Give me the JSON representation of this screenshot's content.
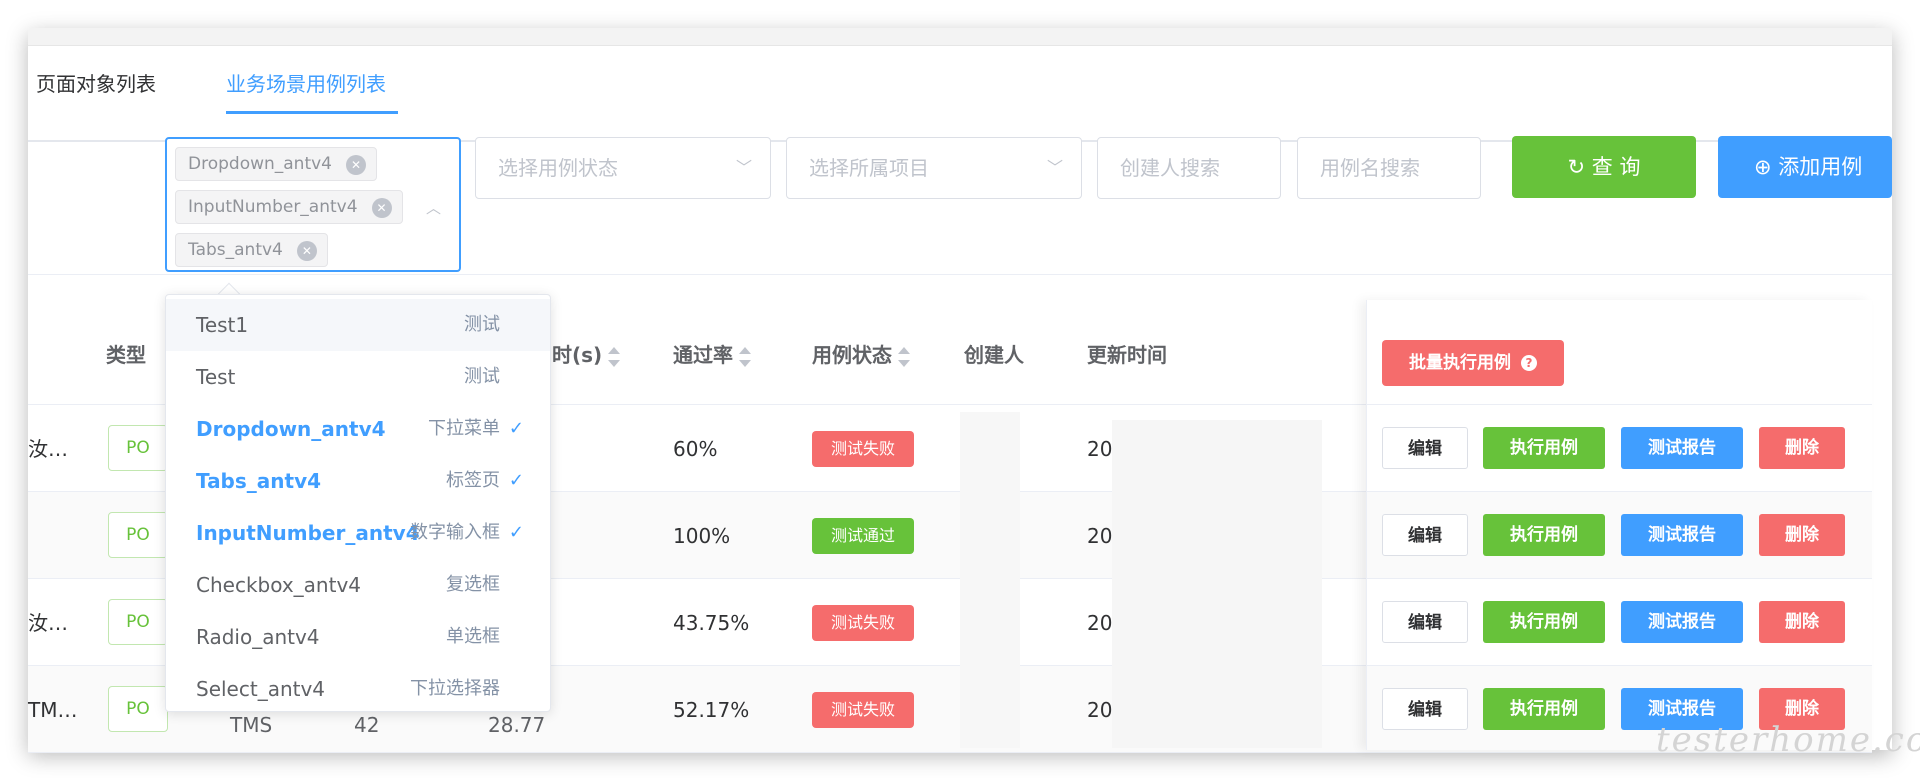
{
  "tabs": [
    {
      "label": "页面对象列表"
    },
    {
      "label": "业务场景用例列表"
    }
  ],
  "filters": {
    "selected_tags": [
      "Dropdown_antv4",
      "InputNumber_antv4",
      "Tabs_antv4"
    ],
    "status_placeholder": "选择用例状态",
    "project_placeholder": "选择所属项目",
    "creator_placeholder": "创建人搜索",
    "case_name_placeholder": "用例名搜索",
    "query_label": "查 询",
    "add_label": "添加用例"
  },
  "table": {
    "headers": {
      "type": "类型",
      "duration": "时(s)",
      "pass_rate": "通过率",
      "status": "用例状态",
      "creator": "创建人",
      "updated": "更新时间"
    },
    "batch_run_label": "批量执行用例",
    "rows": [
      {
        "name": "汝…",
        "type": "PO",
        "pass_rate": "60%",
        "status": "测试失败",
        "status_color": "#f56c6c",
        "updated": "20"
      },
      {
        "name": "",
        "type": "PO",
        "pass_rate": "100%",
        "status": "测试通过",
        "status_color": "#67c23a",
        "updated": "20"
      },
      {
        "name": "汝…",
        "type": "PO",
        "pass_rate": "43.75%",
        "status": "测试失败",
        "status_color": "#f56c6c",
        "updated": "20"
      },
      {
        "name": "TM…",
        "type": "PO",
        "type2": "TMS",
        "count": "42",
        "duration": "28.77",
        "pass_rate": "52.17%",
        "status": "测试失败",
        "status_color": "#f56c6c",
        "updated": "20"
      }
    ],
    "actions": {
      "edit": "编辑",
      "run": "执行用例",
      "report": "测试报告",
      "delete": "删除"
    }
  },
  "dropdown": {
    "items": [
      {
        "name": "Test1",
        "desc": "测试",
        "selected": false
      },
      {
        "name": "Test",
        "desc": "测试",
        "selected": false
      },
      {
        "name": "Dropdown_antv4",
        "desc": "下拉菜单",
        "selected": true
      },
      {
        "name": "Tabs_antv4",
        "desc": "标签页",
        "selected": true
      },
      {
        "name": "InputNumber_antv4",
        "desc": "数字输入框",
        "selected": true
      },
      {
        "name": "Checkbox_antv4",
        "desc": "复选框",
        "selected": false
      },
      {
        "name": "Radio_antv4",
        "desc": "单选框",
        "selected": false
      },
      {
        "name": "Select_antv4",
        "desc": "下拉选择器",
        "selected": false
      }
    ]
  },
  "watermark": "testerhome.com",
  "colors": {
    "primary": "#409eff",
    "success": "#67c23a",
    "danger": "#f56c6c"
  }
}
